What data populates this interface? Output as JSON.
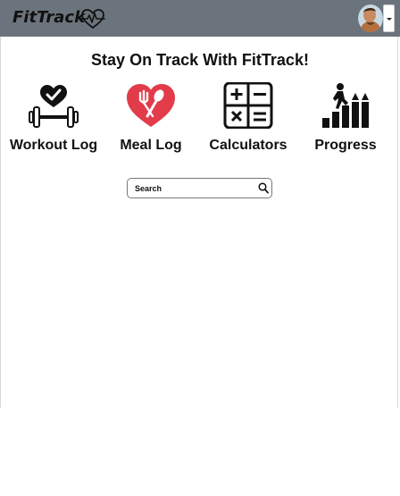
{
  "navbar": {
    "brand": "FitTrack",
    "logo_icon": "heartbeat-heart-icon",
    "avatar_icon": "user-avatar",
    "menu_icon": "caret-down-icon",
    "bg_color": "#6b747c"
  },
  "main": {
    "headline": "Stay On Track With FitTrack!",
    "tiles": [
      {
        "label": "Workout Log",
        "icon": "dumbbell-heart-icon"
      },
      {
        "label": "Meal Log",
        "icon": "fork-spoon-heart-icon"
      },
      {
        "label": "Calculators",
        "icon": "calculator-icon"
      },
      {
        "label": "Progress",
        "icon": "person-climbing-stairs-icon"
      }
    ],
    "search": {
      "placeholder": "Search",
      "value": "",
      "icon": "search-icon"
    }
  },
  "colors": {
    "accent_red": "#e23b4a",
    "text": "#111111"
  }
}
